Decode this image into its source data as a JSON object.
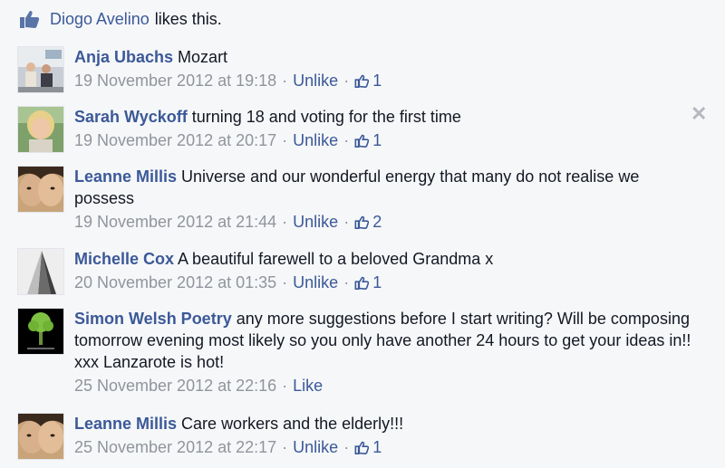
{
  "likes_summary": {
    "name": "Diogo Avelino",
    "suffix": "likes this."
  },
  "comments": [
    {
      "author": "Anja Ubachs",
      "text": "Mozart",
      "timestamp": "19 November 2012 at 19:18",
      "action": "Unlike",
      "like_count": "1"
    },
    {
      "author": "Sarah Wyckoff",
      "text": "turning 18 and voting for the first time",
      "timestamp": "19 November 2012 at 20:17",
      "action": "Unlike",
      "like_count": "1"
    },
    {
      "author": "Leanne Millis",
      "text": "Universe and our wonderful energy that many do not realise we possess",
      "timestamp": "19 November 2012 at 21:44",
      "action": "Unlike",
      "like_count": "2"
    },
    {
      "author": "Michelle Cox",
      "text": "A beautiful farewell to a beloved Grandma x",
      "timestamp": "20 November 2012 at 01:35",
      "action": "Unlike",
      "like_count": "1"
    },
    {
      "author": "Simon Welsh Poetry",
      "text": "any more suggestions before I start writing? Will be composing tomorrow evening most likely so you only have another 24 hours to get your ideas in!! xxx Lanzarote is hot!",
      "timestamp": "25 November 2012 at 22:16",
      "action": "Like"
    },
    {
      "author": "Leanne Millis",
      "text": "Care workers and the elderly!!!",
      "timestamp": "25 November 2012 at 22:17",
      "action": "Unlike",
      "like_count": "1"
    }
  ],
  "icons": {
    "like": "thumbs-up-icon",
    "close": "close-icon"
  },
  "colors": {
    "link": "#3b5998",
    "meta": "#90949c",
    "background": "#f6f7f9"
  }
}
